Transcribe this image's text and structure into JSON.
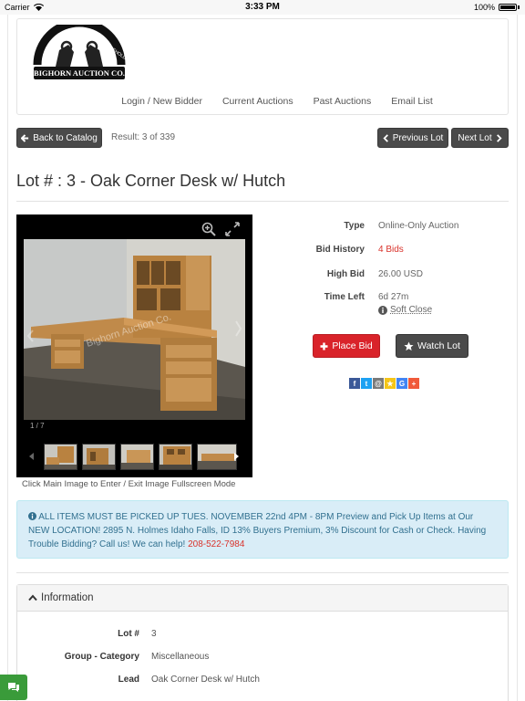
{
  "status_bar": {
    "carrier": "Carrier",
    "time": "3:33 PM",
    "battery": "100%"
  },
  "header": {
    "logo_text": "BIGHORN AUCTION CO.",
    "nav": [
      "Login / New Bidder",
      "Current Auctions",
      "Past Auctions",
      "Email List"
    ]
  },
  "toolbar": {
    "back_label": "Back to Catalog",
    "result": "Result: 3 of 339",
    "prev_label": "Previous Lot",
    "next_label": "Next Lot"
  },
  "lot_title": "Lot # : 3 - Oak Corner Desk w/ Hutch",
  "gallery": {
    "counter": "1 / 7",
    "watermark": "Bighorn Auction Co.",
    "caption": "Click Main Image to Enter / Exit Image Fullscreen Mode",
    "thumb_count": 5
  },
  "details": {
    "type_label": "Type",
    "type_value": "Online-Only Auction",
    "history_label": "Bid History",
    "history_value": "4 Bids",
    "high_label": "High Bid",
    "high_value": "26.00 USD",
    "time_label": "Time Left",
    "time_value": "6d 27m",
    "soft_close": "Soft Close"
  },
  "actions": {
    "place_bid": "Place Bid",
    "watch_lot": "Watch Lot"
  },
  "share_icons": [
    "f",
    "t",
    "@",
    "★",
    "G",
    "+"
  ],
  "notice": {
    "text": "ALL ITEMS MUST BE PICKED UP TUES. NOVEMBER 22nd 4PM - 8PM Preview and Pick Up Items at Our NEW LOCATION! 2895 N. Holmes Idaho Falls, ID 13% Buyers Premium, 3% Discount for Cash or Check. Having Trouble Bidding? Call us! We can help!",
    "phone": "208-522-7984"
  },
  "info": {
    "heading": "Information",
    "lot_label": "Lot #",
    "lot_value": "3",
    "group_label": "Group - Category",
    "group_value": "Miscellaneous",
    "lead_label": "Lead",
    "lead_value": "Oak Corner Desk w/ Hutch"
  },
  "colors": {
    "accent_red": "#d9232a",
    "dark_button": "#4a4a4a",
    "notice_bg": "#d9edf7",
    "chat_green": "#3a9b3a"
  }
}
